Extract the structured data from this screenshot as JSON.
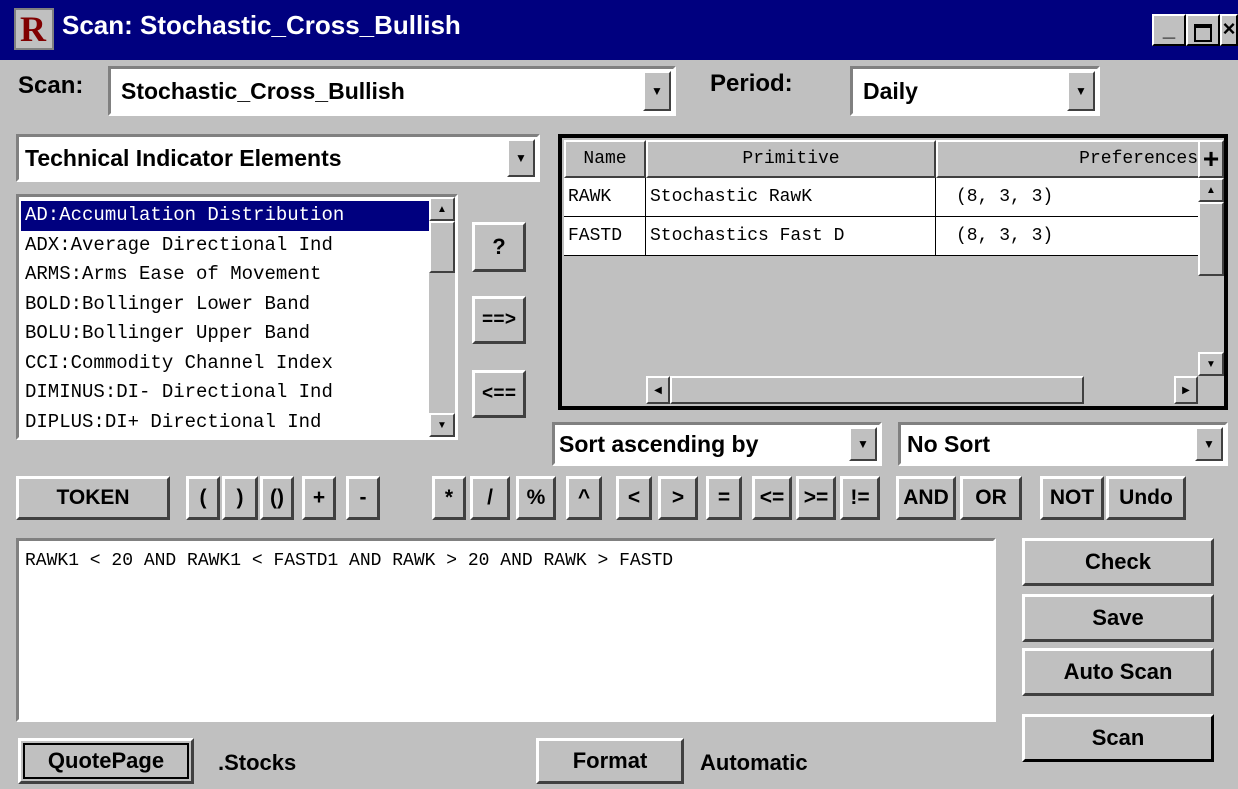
{
  "window": {
    "title": "Scan:  Stochastic_Cross_Bullish",
    "icon": "R"
  },
  "scan": {
    "label": "Scan:",
    "value": "Stochastic_Cross_Bullish"
  },
  "period": {
    "label": "Period:",
    "value": "Daily"
  },
  "elements_dropdown": {
    "value": "Technical Indicator Elements"
  },
  "indicators": [
    "AD:Accumulation Distribution",
    "ADX:Average Directional Ind",
    "ARMS:Arms Ease of Movement",
    "BOLD:Bollinger Lower Band",
    "BOLU:Bollinger Upper Band",
    "CCI:Commodity Channel Index",
    "DIMINUS:DI- Directional Ind",
    "DIPLUS:DI+ Directional Ind"
  ],
  "side_buttons": {
    "help": "?",
    "add": "==>",
    "remove": "<=="
  },
  "grid": {
    "headers": {
      "name": "Name",
      "primitive": "Primitive",
      "preferences": "Preferences",
      "plus": "+"
    },
    "rows": [
      {
        "name": "RAWK",
        "primitive": "Stochastic RawK",
        "preferences": "(8, 3, 3)"
      },
      {
        "name": "FASTD",
        "primitive": "Stochastics Fast D",
        "preferences": "(8, 3, 3)"
      }
    ]
  },
  "sort": {
    "order": "Sort ascending by",
    "field": "No Sort"
  },
  "tokens": [
    "TOKEN",
    "(",
    ")",
    "()",
    "+",
    "-",
    "*",
    "/",
    "%",
    "^",
    "<",
    ">",
    "=",
    "<=",
    ">=",
    "!=",
    "AND",
    "OR",
    "NOT",
    "Undo"
  ],
  "expression": "RAWK1 < 20 AND RAWK1 < FASTD1 AND RAWK > 20 AND RAWK > FASTD",
  "actions": {
    "check": "Check",
    "save": "Save",
    "auto_scan": "Auto Scan",
    "scan": "Scan"
  },
  "footer": {
    "quotepage": "QuotePage",
    "stocks": ".Stocks",
    "format": "Format",
    "automatic": "Automatic"
  }
}
